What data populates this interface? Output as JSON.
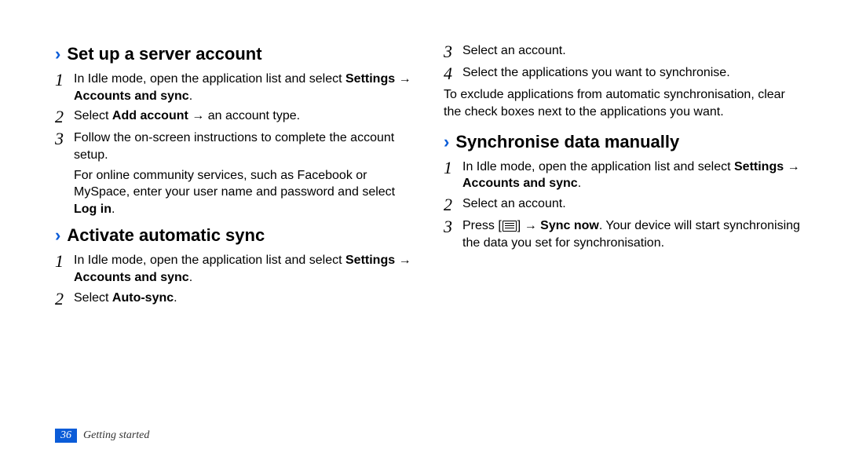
{
  "footer": {
    "page": "36",
    "section": "Getting started"
  },
  "left": {
    "s1": {
      "title": "Set up a server account",
      "steps": [
        {
          "n": "1",
          "pre": "In Idle mode, open the application list and select ",
          "bold": "Settings → Accounts and sync",
          "post": "."
        },
        {
          "n": "2",
          "pre": "Select ",
          "bold": "Add account",
          "post": " → an account type."
        },
        {
          "n": "3",
          "pre": "Follow the on-screen instructions to complete the account setup."
        }
      ],
      "note_pre": "For online community services, such as Facebook or MySpace, enter your user name and password and select ",
      "note_bold": "Log in",
      "note_post": "."
    },
    "s2": {
      "title": "Activate automatic sync",
      "steps": [
        {
          "n": "1",
          "pre": "In Idle mode, open the application list and select ",
          "bold": "Settings → Accounts and sync",
          "post": "."
        },
        {
          "n": "2",
          "pre": "Select ",
          "bold": "Auto-sync",
          "post": "."
        }
      ]
    }
  },
  "right": {
    "top_steps": [
      {
        "n": "3",
        "pre": "Select an account."
      },
      {
        "n": "4",
        "pre": "Select the applications you want to synchronise."
      }
    ],
    "top_note": "To exclude applications from automatic synchronisation, clear the check boxes next to the applications you want.",
    "s3": {
      "title": "Synchronise data manually",
      "steps": [
        {
          "n": "1",
          "pre": "In Idle mode, open the application list and select ",
          "bold": "Settings → Accounts and sync",
          "post": "."
        },
        {
          "n": "2",
          "pre": "Select an account."
        },
        {
          "n": "3",
          "pre": "Press [",
          "icon": true,
          "mid": "] → ",
          "bold": "Sync now",
          "post": ". Your device will start synchronising the data you set for synchronisation."
        }
      ]
    }
  }
}
